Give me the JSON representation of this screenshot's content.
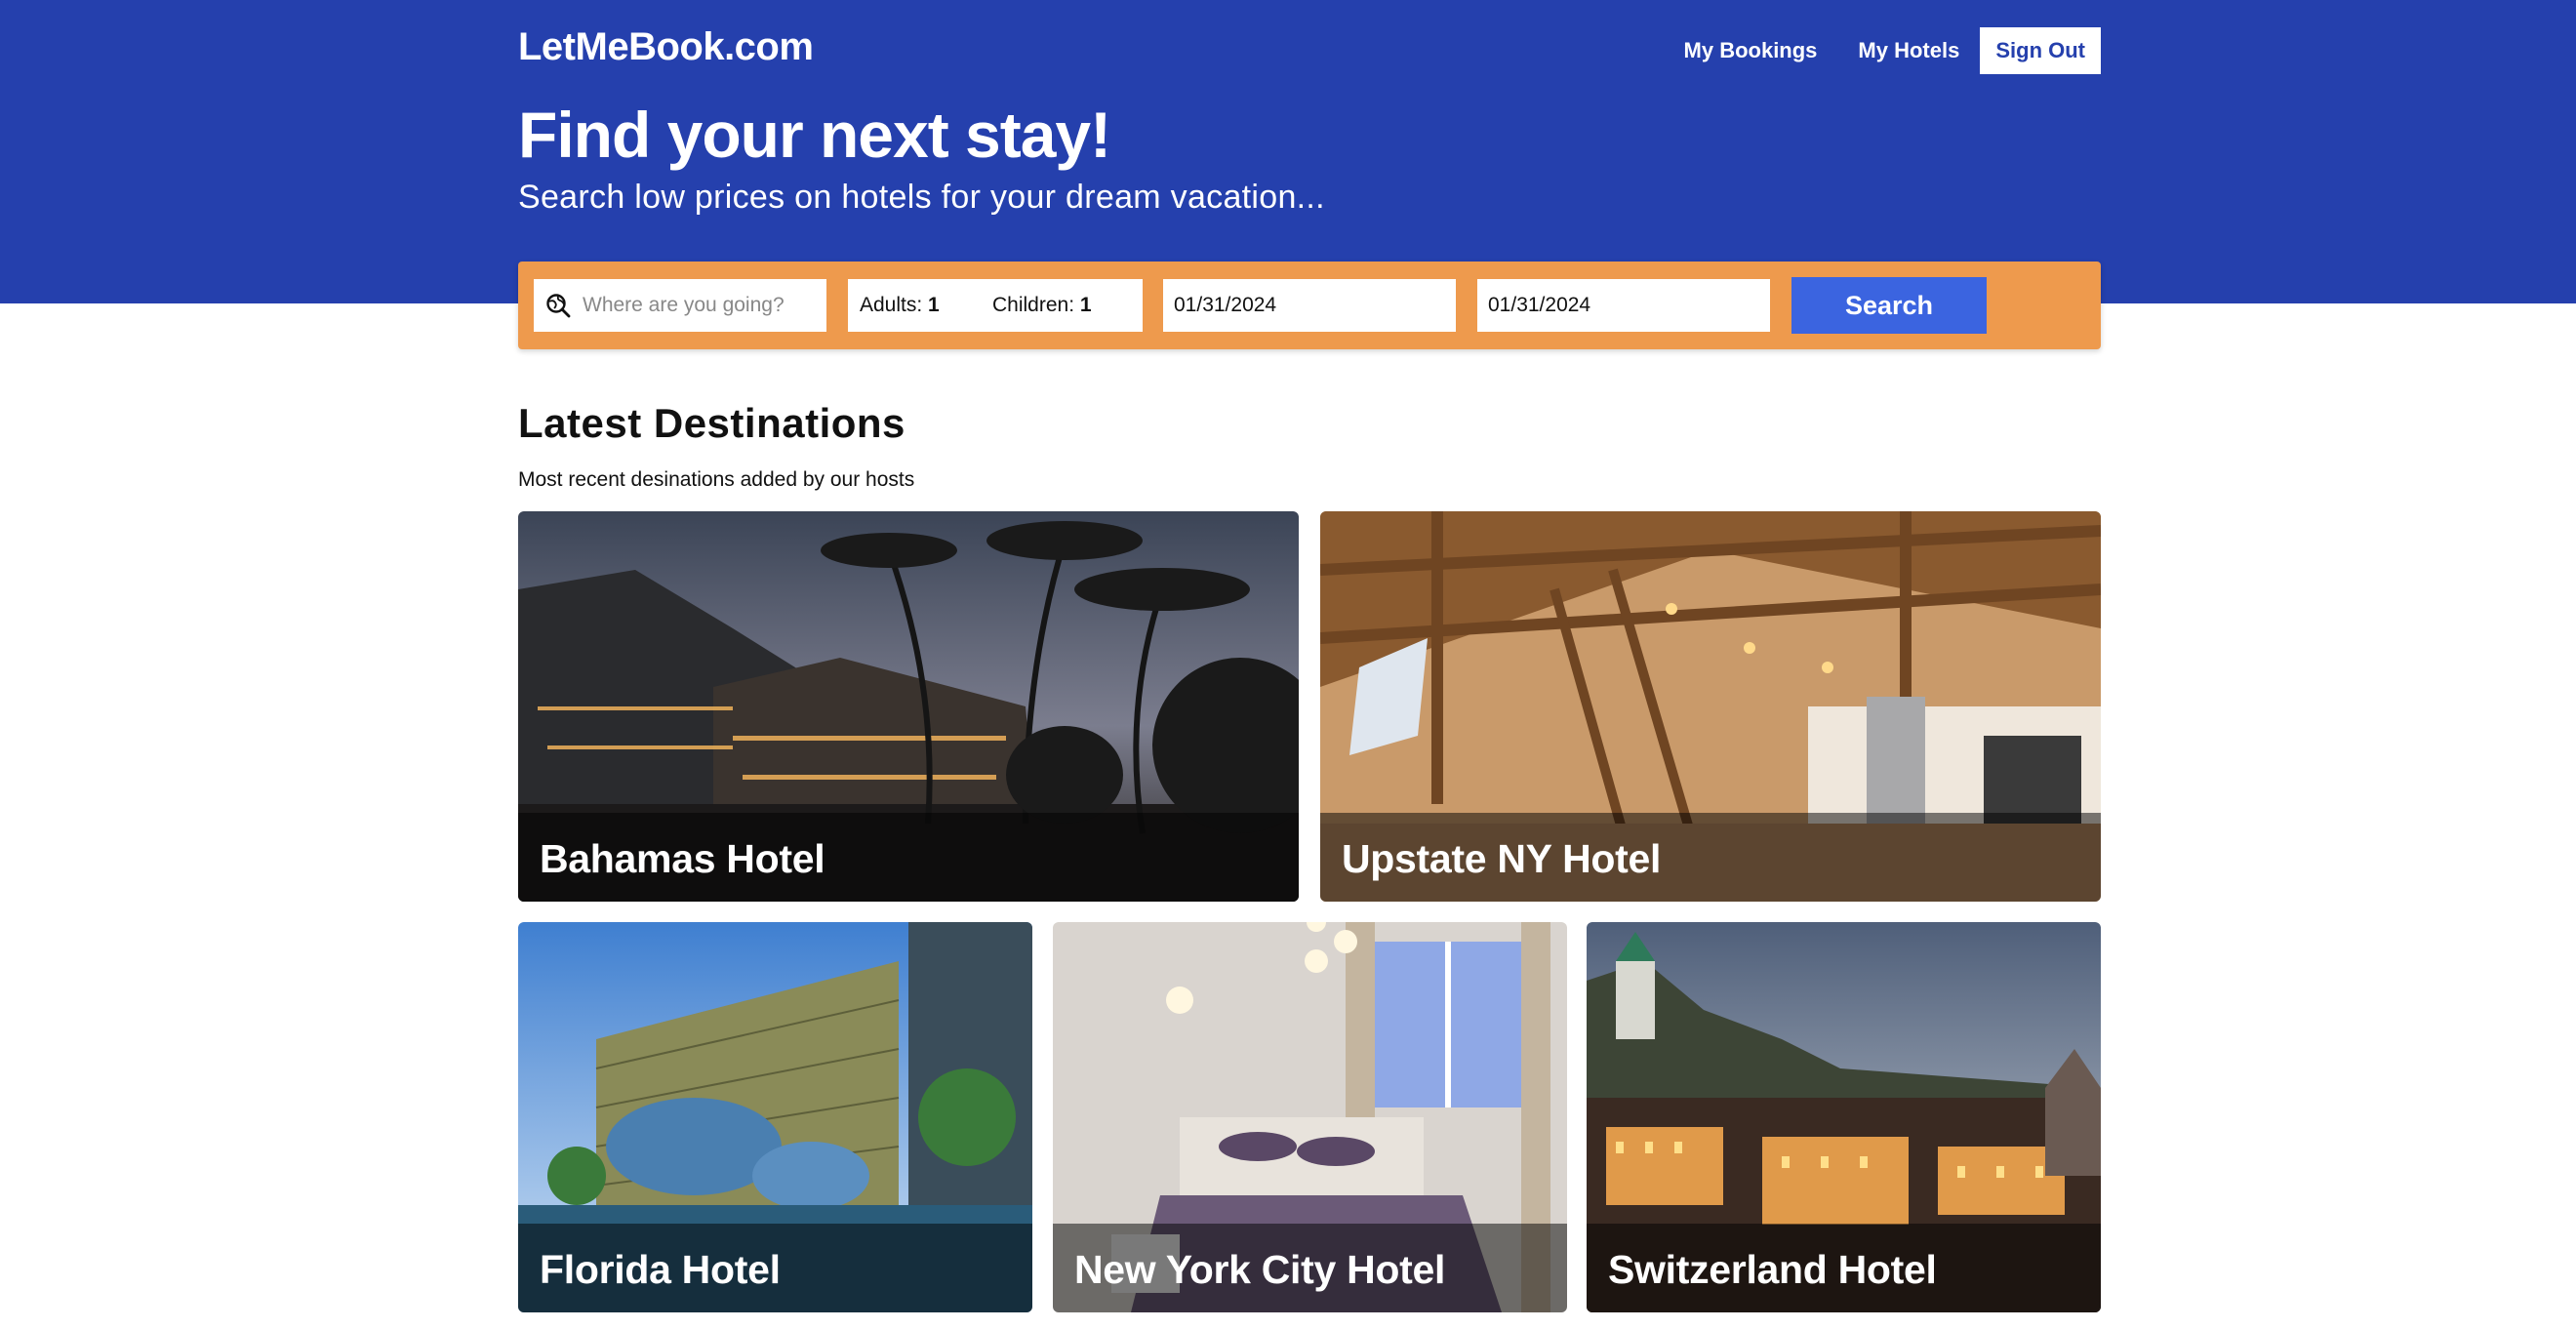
{
  "header": {
    "brand": "LetMeBook.com",
    "nav": {
      "bookings": "My Bookings",
      "hotels": "My Hotels",
      "sign_out": "Sign Out"
    }
  },
  "hero": {
    "title": "Find your next stay!",
    "subtitle": "Search low prices on hotels for your dream vacation..."
  },
  "search": {
    "destination_placeholder": "Where are you going?",
    "adults_label": "Adults:",
    "adults_value": "1",
    "children_label": "Children:",
    "children_value": "1",
    "check_in": "01/31/2024",
    "check_out": "01/31/2024",
    "button": "Search"
  },
  "destinations": {
    "title": "Latest Destinations",
    "subtitle": "Most recent desinations added by our hosts",
    "items": [
      {
        "name": "Bahamas Hotel"
      },
      {
        "name": "Upstate NY Hotel"
      },
      {
        "name": "Florida Hotel"
      },
      {
        "name": "New York City Hotel"
      },
      {
        "name": "Switzerland Hotel"
      }
    ]
  },
  "colors": {
    "hero_bg": "#2540ad",
    "search_bar": "#ee9a4d",
    "search_button": "#3b64e0"
  }
}
